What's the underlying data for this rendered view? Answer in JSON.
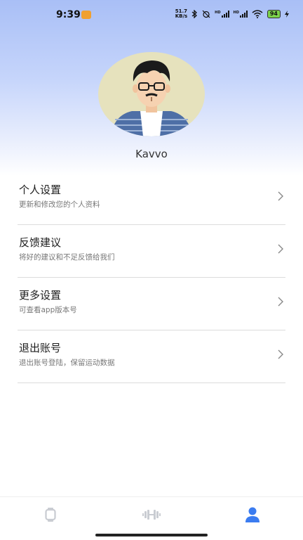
{
  "status_bar": {
    "time": "9:39",
    "net_speed_value": "51.7",
    "net_speed_unit": "KB/s",
    "battery": "94",
    "hd_label": "HD"
  },
  "profile": {
    "username": "Kavvo"
  },
  "menu": [
    {
      "title": "个人设置",
      "subtitle": "更新和修改您的个人资料"
    },
    {
      "title": "反馈建议",
      "subtitle": "将好的建议和不足反馈给我们"
    },
    {
      "title": "更多设置",
      "subtitle": "可查看app版本号"
    },
    {
      "title": "退出账号",
      "subtitle": "退出账号登陆，保留运动数据"
    }
  ],
  "bottom_nav": {
    "items": [
      {
        "icon": "watch-icon",
        "active": false
      },
      {
        "icon": "dumbbell-icon",
        "active": false
      },
      {
        "icon": "person-icon",
        "active": true
      }
    ],
    "active_color": "#3b7cf0",
    "inactive_color": "#c9ccd2"
  },
  "colors": {
    "header_gradient_top": "#a9bff6",
    "divider": "#dcdcdc"
  }
}
